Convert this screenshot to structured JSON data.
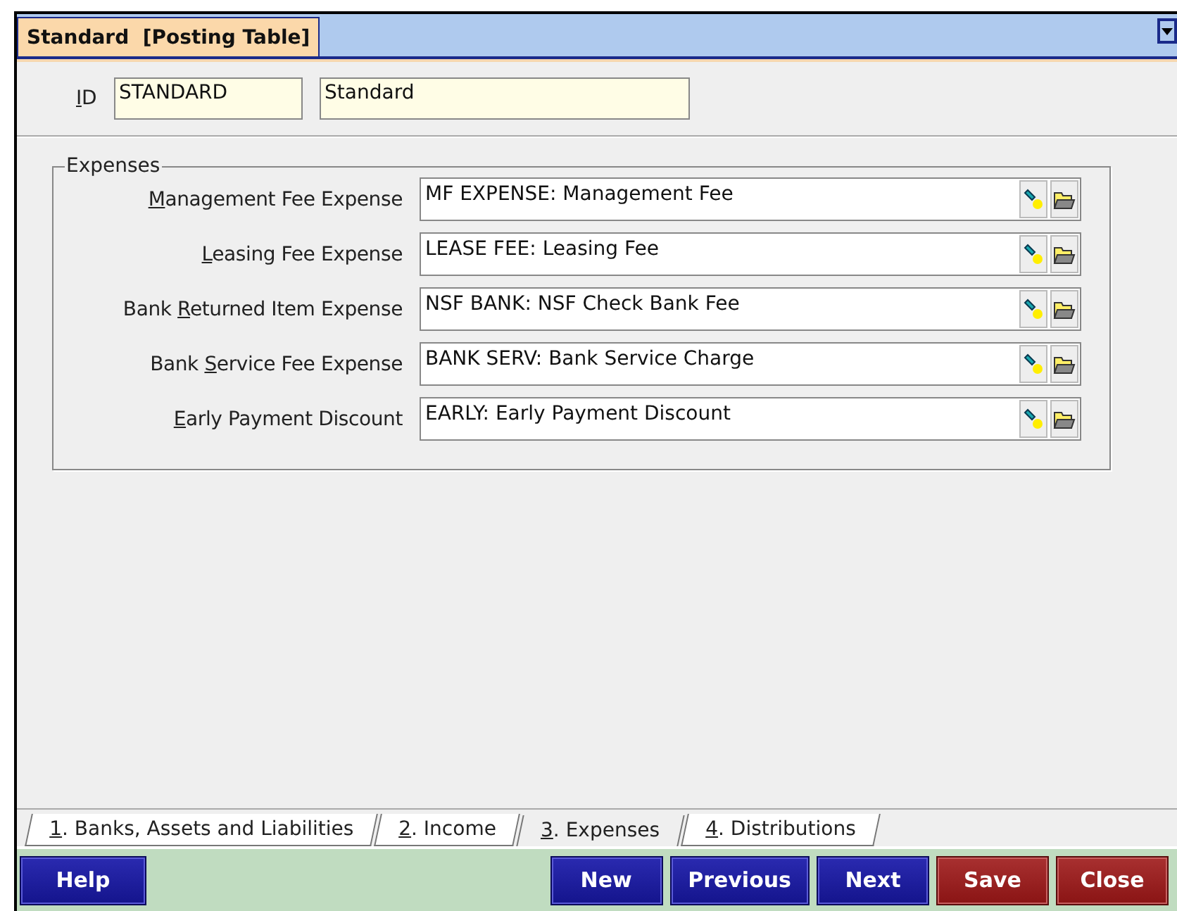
{
  "title_tab": {
    "label": "Standard  [Posting Table]",
    "selected": true
  },
  "id_row": {
    "label": {
      "key": "I",
      "post": "D"
    },
    "code": "STANDARD",
    "name": "Standard"
  },
  "group": {
    "title": "Expenses",
    "fields": [
      {
        "label": {
          "key": "M",
          "post": "anagement Fee Expense"
        },
        "value": "MF EXPENSE: Management Fee"
      },
      {
        "label": {
          "key": "L",
          "post": "easing Fee Expense"
        },
        "value": "LEASE FEE: Leasing Fee"
      },
      {
        "label": {
          "pre": "Bank ",
          "key": "R",
          "post": "eturned Item Expense"
        },
        "value": "NSF BANK: NSF Check Bank Fee"
      },
      {
        "label": {
          "pre": "Bank ",
          "key": "S",
          "post": "ervice Fee Expense"
        },
        "value": "BANK SERV: Bank Service Charge"
      },
      {
        "label": {
          "key": "E",
          "post": "arly Payment Discount"
        },
        "value": "EARLY: Early Payment Discount"
      }
    ]
  },
  "tabs": [
    {
      "key": "1",
      "label": ". Banks, Assets and Liabilities",
      "selected": false
    },
    {
      "key": "2",
      "label": ". Income",
      "selected": false
    },
    {
      "key": "3",
      "label": ". Expenses",
      "selected": true
    },
    {
      "key": "4",
      "label": ". Distributions",
      "selected": false
    }
  ],
  "left_buttons": [
    {
      "label": "Help",
      "kind": "blue"
    }
  ],
  "right_buttons": [
    {
      "label": "New",
      "kind": "blue"
    },
    {
      "label": "Previous",
      "kind": "blue"
    },
    {
      "label": "Next",
      "kind": "blue"
    },
    {
      "label": "Save",
      "kind": "red"
    },
    {
      "label": "Close",
      "kind": "red"
    }
  ]
}
